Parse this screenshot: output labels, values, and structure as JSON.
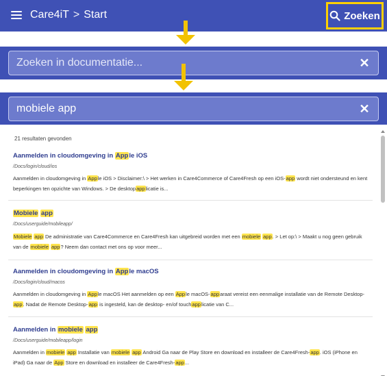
{
  "app": {
    "name": "Care4iT",
    "page": "Start",
    "separator": ">"
  },
  "header": {
    "search_label": "Zoeken"
  },
  "search_empty": {
    "placeholder": "Zoeken in documentatie...",
    "clear": "✕"
  },
  "search_filled": {
    "value": "mobiele app",
    "clear": "✕"
  },
  "results": {
    "count": "21 resultaten gevonden",
    "items": [
      {
        "title": [
          "Aanmelden in cloudomgeving in ",
          {
            "h": "App"
          },
          "le iOS"
        ],
        "path": "/Docs/login/cloud/ios",
        "snippet": [
          "Aanmelden in cloudomgeving in ",
          {
            "h": "App"
          },
          "le iOS > Disclaimer:\\ > Het werken in Care4Commerce of Care4Fresh op een iOS-",
          {
            "h": "app"
          },
          " wordt niet ondersteund en kent beperkingen ten opzichte van Windows. > De desktop",
          {
            "h": "app"
          },
          "licatie is..."
        ]
      },
      {
        "title": [
          {
            "h": "Mobiele"
          },
          " ",
          {
            "h": "app"
          }
        ],
        "path": "/Docs/userguide/mobileapp/",
        "snippet": [
          {
            "h": "Mobiele"
          },
          " ",
          {
            "h": "app"
          },
          " De administratie van Care4Commerce en Care4Fresh kan uitgebreid worden met een ",
          {
            "h": "mobiele"
          },
          " ",
          {
            "h": "app"
          },
          ". > Let op:\\ > Maakt u nog geen gebruik van de ",
          {
            "h": "mobiele"
          },
          " ",
          {
            "h": "app"
          },
          "? Neem dan contact met ons op voor meer..."
        ]
      },
      {
        "title": [
          "Aanmelden in cloudomgeving in ",
          {
            "h": "App"
          },
          "le macOS"
        ],
        "path": "/Docs/login/cloud/macos",
        "snippet": [
          "Aanmelden in cloudomgeving in ",
          {
            "h": "App"
          },
          "le macOS Het aanmelden op een ",
          {
            "h": "App"
          },
          "le macOS-",
          {
            "h": "app"
          },
          "araat vereist een eenmalige installatie van de Remote Desktop-",
          {
            "h": "app"
          },
          ". Nadat de Remote Desktop-",
          {
            "h": "app"
          },
          " is ingesteld, kan de desktop- en/of touch",
          {
            "h": "app"
          },
          "licatie van C..."
        ]
      },
      {
        "title": [
          "Aanmelden in ",
          {
            "h": "mobiele"
          },
          " ",
          {
            "h": "app"
          }
        ],
        "path": "/Docs/userguide/mobileapp/login",
        "snippet": [
          "Aanmelden in ",
          {
            "h": "mobiele"
          },
          " ",
          {
            "h": "app"
          },
          " Installatie van ",
          {
            "h": "mobiele"
          },
          " ",
          {
            "h": "app"
          },
          " Android Ga naar de Play Store en download en installeer de Care4Fresh-",
          {
            "h": "app"
          },
          ". iOS (iPhone en iPad) Ga naar de ",
          {
            "h": "App"
          },
          " Store en download en installeer de Care4Fresh-",
          {
            "h": "app"
          },
          "..."
        ]
      }
    ]
  },
  "colors": {
    "primary": "#3f51b5",
    "field": "#6d7bcd",
    "accent": "#ffd000",
    "highlight": "#ffe44d",
    "link": "#2f3d8f"
  },
  "icons": {
    "menu": "hamburger-icon",
    "search": "magnifier-icon",
    "clear": "close-icon",
    "arrow": "arrow-down-icon"
  }
}
